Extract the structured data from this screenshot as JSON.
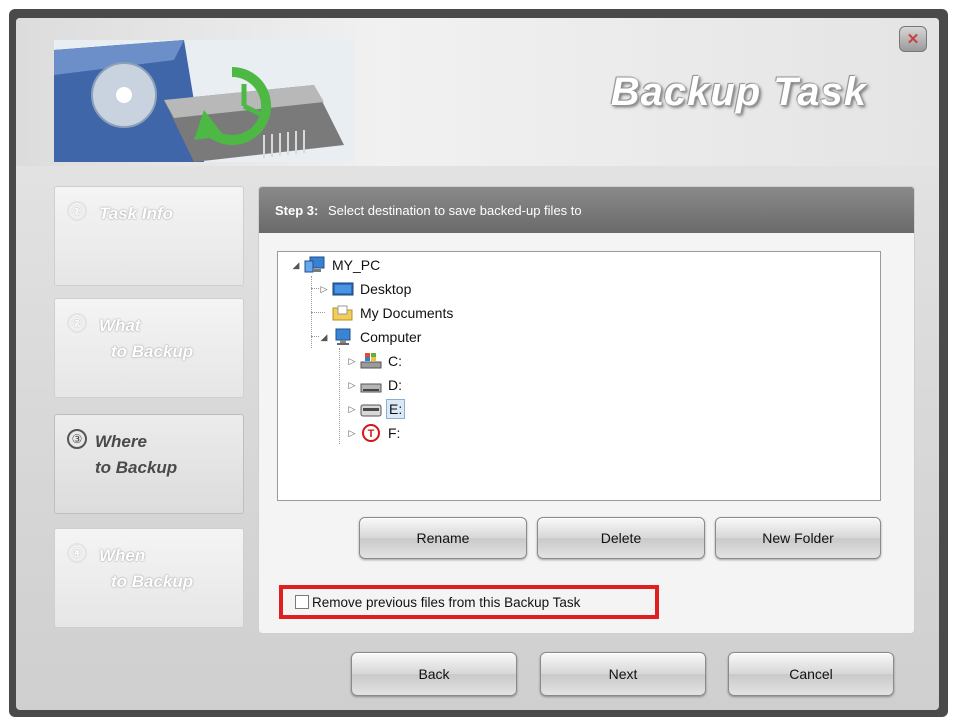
{
  "window": {
    "title": "Backup Task",
    "close_icon": "close-icon"
  },
  "steps": [
    {
      "number": "①",
      "line1": "Task Info",
      "line2": "",
      "active": false
    },
    {
      "number": "②",
      "line1": "What",
      "line2": "to Backup",
      "active": false
    },
    {
      "number": "③",
      "line1": "Where",
      "line2": "to Backup",
      "active": true
    },
    {
      "number": "④",
      "line1": "When",
      "line2": "to Backup",
      "active": false
    }
  ],
  "panel": {
    "step_label": "Step 3:",
    "step_text": "Select destination to save backed-up files to"
  },
  "tree": {
    "root": "MY_PC",
    "desktop": "Desktop",
    "my_documents": "My Documents",
    "computer": "Computer",
    "drives": [
      "C:",
      "D:",
      "E:",
      "F:"
    ],
    "selected": "E:"
  },
  "actions": {
    "rename": "Rename",
    "delete": "Delete",
    "new_folder": "New Folder"
  },
  "options": {
    "remove_previous": "Remove previous files from this Backup Task",
    "remove_previous_checked": false
  },
  "footer": {
    "back": "Back",
    "next": "Next",
    "cancel": "Cancel"
  },
  "colors": {
    "highlight": "#e02020",
    "header": "#6f6f6f"
  }
}
